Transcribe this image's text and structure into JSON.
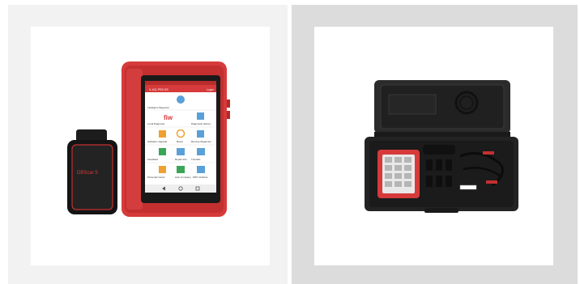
{
  "products": [
    {
      "name": "tablet-with-obd-dongle",
      "tablet": {
        "title": "X-431 PRO 5S",
        "header_right": "Login",
        "sections": [
          "Intelligent Diagnosis",
          "Local Diagnosis",
          "Diagnostic History",
          "Software Upgrade",
          "Reset",
          "Remote Diagnosis",
          "Feedback",
          "Repair Info",
          "Tutorials",
          "Personal Center",
          "Auto Company",
          "PRO Vehicles"
        ]
      },
      "dongle": {
        "label": "DBScar 5"
      }
    },
    {
      "name": "carrying-case-with-cables"
    }
  ],
  "colors": {
    "tablet_red": "#d63a3a",
    "case_black": "#1e1e1e"
  }
}
